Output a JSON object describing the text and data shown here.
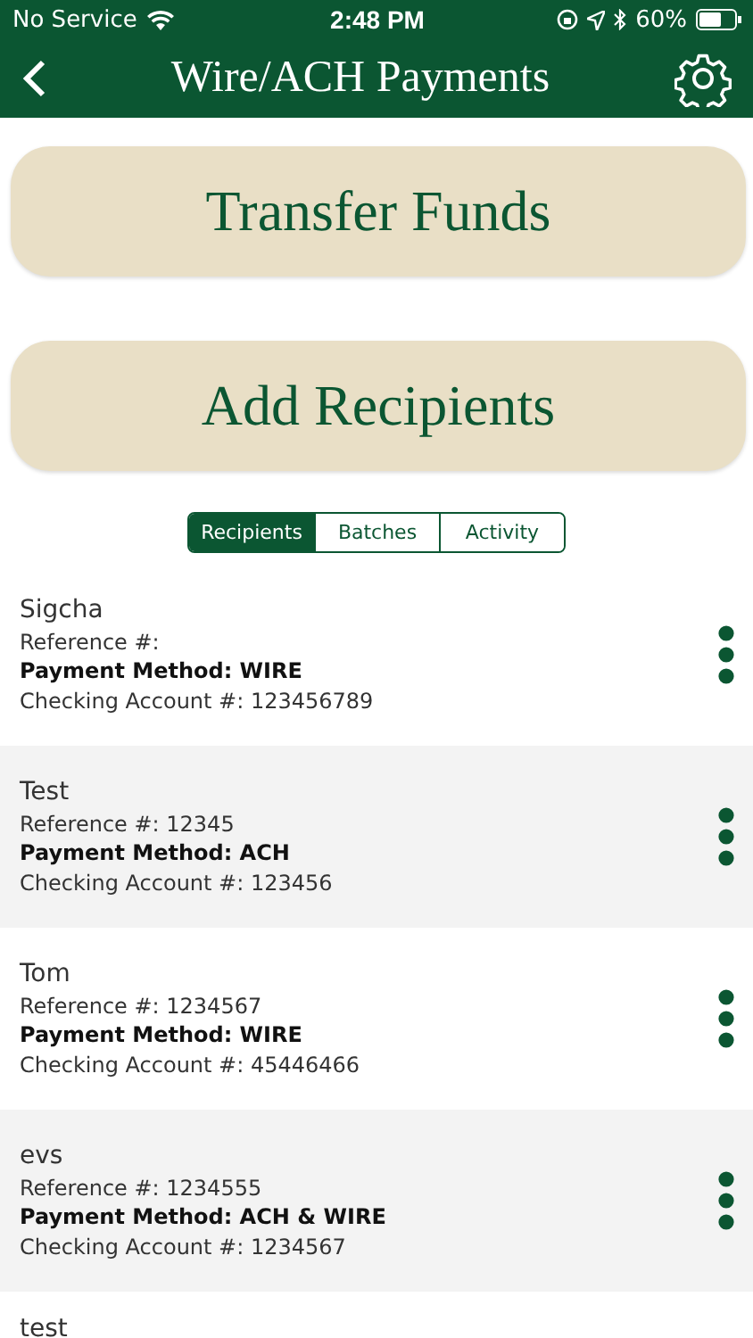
{
  "status_bar": {
    "carrier": "No Service",
    "time": "2:48 PM",
    "battery": "60%"
  },
  "nav": {
    "title": "Wire/ACH Payments"
  },
  "actions": [
    "Transfer Funds",
    "Add Recipients"
  ],
  "tabs": [
    {
      "label": "Recipients",
      "selected": true
    },
    {
      "label": "Batches",
      "selected": false
    },
    {
      "label": "Activity",
      "selected": false
    }
  ],
  "recipients": [
    {
      "name": "Sigcha",
      "reference": "Reference #:",
      "method": "Payment Method: WIRE",
      "account": "Checking Account #: 123456789"
    },
    {
      "name": "Test",
      "reference": "Reference #: 12345",
      "method": "Payment Method: ACH",
      "account": "Checking Account #: 123456"
    },
    {
      "name": "Tom",
      "reference": "Reference #: 1234567",
      "method": "Payment Method: WIRE",
      "account": "Checking Account #: 45446466"
    },
    {
      "name": "evs",
      "reference": "Reference #: 1234555",
      "method": "Payment Method: ACH & WIRE",
      "account": "Checking Account #: 1234567"
    },
    {
      "name": "test"
    }
  ]
}
